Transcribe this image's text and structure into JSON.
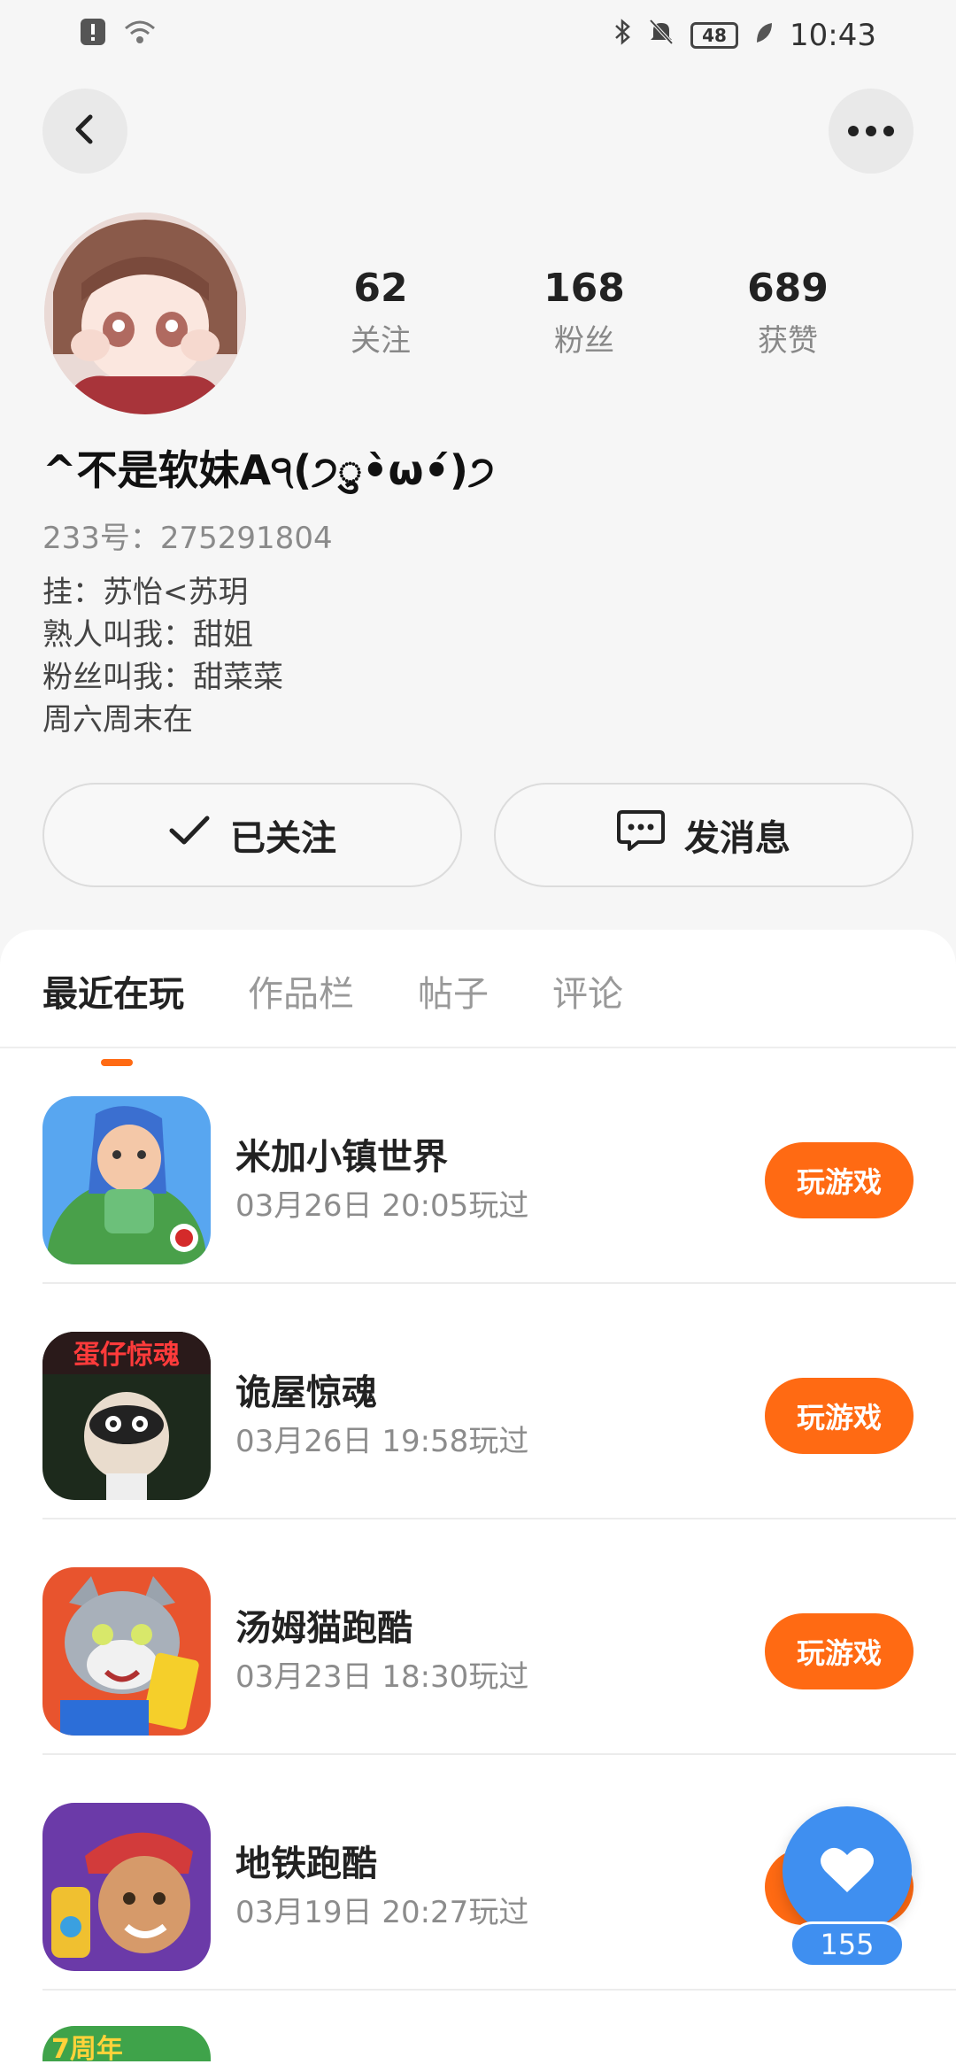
{
  "status_bar": {
    "time": "10:43",
    "battery": "48",
    "icons": [
      "alert-icon",
      "wifi-icon",
      "bluetooth-icon",
      "mute-icon",
      "battery-icon",
      "eco-icon"
    ]
  },
  "header": {
    "back_icon": "chevron-left-icon",
    "more_icon": "more-horizontal-icon"
  },
  "profile": {
    "stats": [
      {
        "value": "62",
        "label": "关注"
      },
      {
        "value": "168",
        "label": "粉丝"
      },
      {
        "value": "689",
        "label": "获赞"
      }
    ],
    "username": "^不是软妹A੧(੭ु•̀ω•́)੭",
    "user_id": "233号：275291804",
    "bio": [
      "挂：苏怡<苏玥",
      "熟人叫我：甜姐",
      "粉丝叫我：甜菜菜",
      "周六周末在"
    ],
    "follow_label": "已关注",
    "message_label": "发消息"
  },
  "tabs": [
    "最近在玩",
    "作品栏",
    "帖子",
    "评论"
  ],
  "games": [
    {
      "name": "米加小镇世界",
      "time": "03月26日 20:05玩过",
      "button": "玩游戏",
      "icon": "miga-town-icon"
    },
    {
      "name": "诡屋惊魂",
      "time": "03月26日 19:58玩过",
      "button": "玩游戏",
      "icon": "haunted-house-icon",
      "icon_text": "蛋仔惊魂"
    },
    {
      "name": "汤姆猫跑酷",
      "time": "03月23日 18:30玩过",
      "button": "玩游戏",
      "icon": "tom-cat-icon"
    },
    {
      "name": "地铁跑酷",
      "time": "03月19日 20:27玩过",
      "button": "玩游戏",
      "icon": "subway-surfers-icon"
    }
  ],
  "partial_icon_text": "7周年",
  "like": {
    "count": "155",
    "icon": "heart-icon"
  },
  "colors": {
    "accent": "#ff6a13",
    "like_blue": "#3f8ff0",
    "background": "#f6f6f6"
  }
}
